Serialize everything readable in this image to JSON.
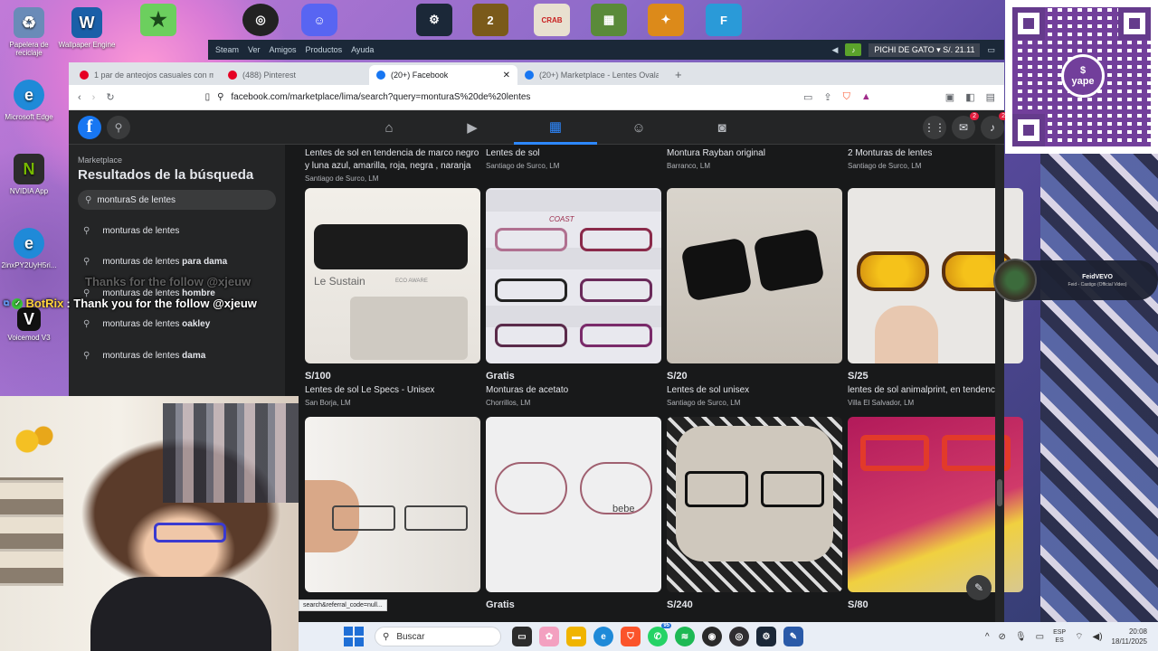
{
  "desktop": {
    "icons": [
      {
        "label": "Papelera de reciclaje",
        "glyph": "♻",
        "color": "#6a8bb8"
      },
      {
        "label": "Wallpaper Engine",
        "glyph": "W",
        "color": "#1a5fa8"
      },
      {
        "label": "Microsoft Edge",
        "glyph": "e",
        "color": "#1f8ad8"
      },
      {
        "label": "NVIDIA App",
        "glyph": "N",
        "color": "#2c2c2c"
      },
      {
        "label": "2inxPY2UyH5ri...",
        "glyph": "e",
        "color": "#1f8ad8"
      },
      {
        "label": "Voicemod V3",
        "glyph": "V",
        "color": "#111111"
      }
    ]
  },
  "steam": {
    "logo": "Steam",
    "menu": [
      "Ver",
      "Amigos",
      "Productos",
      "Ayuda"
    ],
    "user": "PICHI DE GATO",
    "balance": "S/. 21.11"
  },
  "browser": {
    "tabs": [
      {
        "label": "1 par de anteojos casuales con mont",
        "color": "#e60023"
      },
      {
        "label": "(488) Pinterest",
        "color": "#e60023"
      },
      {
        "label": "(20+) Facebook",
        "color": "#1877f2"
      },
      {
        "label": "(20+) Marketplace - Lentes Ovalado",
        "color": "#1877f2"
      }
    ],
    "newtab": "+",
    "url": "facebook.com/marketplace/lima/search?query=monturaS%20de%20lentes"
  },
  "facebook": {
    "logo": "f",
    "sidebar": {
      "subtitle": "Marketplace",
      "title": "Resultados de la búsqueda",
      "query": "monturaS de lentes",
      "suggestions": [
        {
          "base": "monturas de lentes",
          "bold": ""
        },
        {
          "base": "monturas de lentes",
          "bold": "para dama"
        },
        {
          "base": "monturas de lentes",
          "bold": "hombre"
        },
        {
          "base": "monturas de lentes",
          "bold": "oakley"
        },
        {
          "base": "monturas de lentes",
          "bold": "dama"
        }
      ]
    },
    "top_row": [
      {
        "title": "Lentes de sol en tendencia de marco negro y luna azul, amarilla, roja, negra , naranja",
        "location": "Santiago de Surco, LM"
      },
      {
        "title": "Lentes de sol",
        "location": "Santiago de Surco, LM"
      },
      {
        "title": "Montura Rayban original",
        "location": "Barranco, LM"
      },
      {
        "title": "2 Monturas de lentes",
        "location": "Santiago de Surco, LM"
      }
    ],
    "listings": [
      {
        "price": "S/100",
        "title": "Lentes de sol Le Specs - Unisex",
        "location": "San Borja, LM",
        "img": "sustain"
      },
      {
        "price": "Gratis",
        "title": "Monturas de acetato",
        "location": "Chorrillos, LM",
        "img": "acetato"
      },
      {
        "price": "S/20",
        "title": "Lentes de sol unisex",
        "location": "Santiago de Surco, LM",
        "img": "black"
      },
      {
        "price": "S/25",
        "title": "lentes de sol animalprint, en tendencia",
        "location": "Villa El Salvador, LM",
        "img": "yellow"
      },
      {
        "price": "",
        "title": "",
        "location": "",
        "img": "hand"
      },
      {
        "price": "Gratis",
        "title": "",
        "location": "",
        "img": "bebe"
      },
      {
        "price": "S/240",
        "title": "",
        "location": "",
        "img": "case"
      },
      {
        "price": "S/80",
        "title": "",
        "location": "",
        "img": "red"
      }
    ],
    "img_text": {
      "sustain": "Le Sustain",
      "sustain_sub": "ECO AWARE",
      "bebe": "bebe",
      "acetato": "COAST"
    }
  },
  "status_url": "search&referral_code=null...",
  "overlays": {
    "botrix": {
      "name": "BotRix",
      "message": " : Thank you for the follow @xjeuw",
      "ghost": "Thanks for the follow @xjeuw"
    },
    "music": {
      "artist": "FeidVEVO",
      "track": "Feid - Castigo (Official Video)"
    },
    "yape": "yape"
  },
  "taskbar": {
    "search": "Buscar",
    "whatsapp_badge": "95",
    "lang_top": "ESP",
    "lang_bottom": "ES",
    "time": "20:08",
    "date": "18/11/2025"
  }
}
